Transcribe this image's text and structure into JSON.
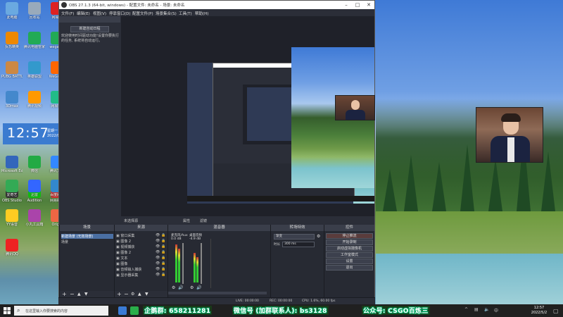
{
  "obs": {
    "title": "OBS 27.1.3 (64-bit, windows) - 配置文件: 未命名 - 场景: 未命名",
    "menu": [
      "文件(F)",
      "编辑(E)",
      "视图(V)",
      "停靠窗口(D)",
      "配置文件(P)",
      "场景集合(S)",
      "工具(T)",
      "帮助(H)"
    ],
    "left_panel": {
      "button": "新建自动日程",
      "text": "欢迎使用时间驱动功能!设置你要执行的任务, 系统将自动运行。"
    },
    "preview_label": "未选择源",
    "preview_buttons": [
      "属性",
      "滤镜"
    ],
    "docks": {
      "scenes": {
        "title": "场景",
        "items": [
          "新建场景 (无效场景)",
          "场景"
        ]
      },
      "sources": {
        "title": "来源",
        "items": [
          "窗口采集",
          "图像 2",
          "视频捕获",
          "图像 2",
          "文本",
          "图像",
          "音频输入捕获",
          "显示器采集"
        ]
      },
      "mixer": {
        "title": "混音器",
        "channels": [
          {
            "name": "麦克风/Aux",
            "db": "0.0 dB"
          },
          {
            "name": "桌面音频",
            "db": "-4.9 dB"
          }
        ]
      },
      "transitions": {
        "title": "转场特效",
        "type": "渐变",
        "duration_label": "时长",
        "duration": "300 ms"
      },
      "controls": {
        "title": "控件",
        "buttons": [
          "停止推流",
          "开始录制",
          "启动虚拟摄像机",
          "工作室模式",
          "设置",
          "退出"
        ]
      }
    },
    "status": {
      "live": "LIVE: 00:00:00",
      "rec": "REC: 00:00:00",
      "cpu": "CPU: 1.6%, 60.00 fps"
    }
  },
  "desktop": {
    "icons": [
      "此电脑",
      "回收站",
      "网易云",
      "反恐精英",
      "腾讯电脑管家",
      "wegame",
      "PUBG BATTLEGR...",
      "英雄联盟",
      "WeGame",
      "3Dmax",
      "腾讯视频",
      "网易UU",
      "Microsoft Edge",
      "微信",
      "腾讯文档",
      "OBS Studio",
      "Audition",
      "网易邮箱",
      "爱奇艺",
      "迅雷",
      "百度网盘",
      "YY语音",
      "小丸工具箱",
      "Origin",
      "腾讯QQ"
    ],
    "clock": {
      "time": "12:57",
      "date": "星期一 2022/05/02"
    }
  },
  "taskbar": {
    "search_placeholder": "在这里输入你要搜索的内容",
    "overlays": [
      "企鹅群: 658211281",
      "微信号 (加群联系人): bs3128",
      "公众号: CSGO百炼三"
    ],
    "tray_time": "12:57",
    "tray_date": "2022/5/2"
  },
  "colors": {
    "obs_bg": "#2b2e38",
    "selected_row": "#4a6fa3",
    "overlay_text": "#00aa66"
  }
}
